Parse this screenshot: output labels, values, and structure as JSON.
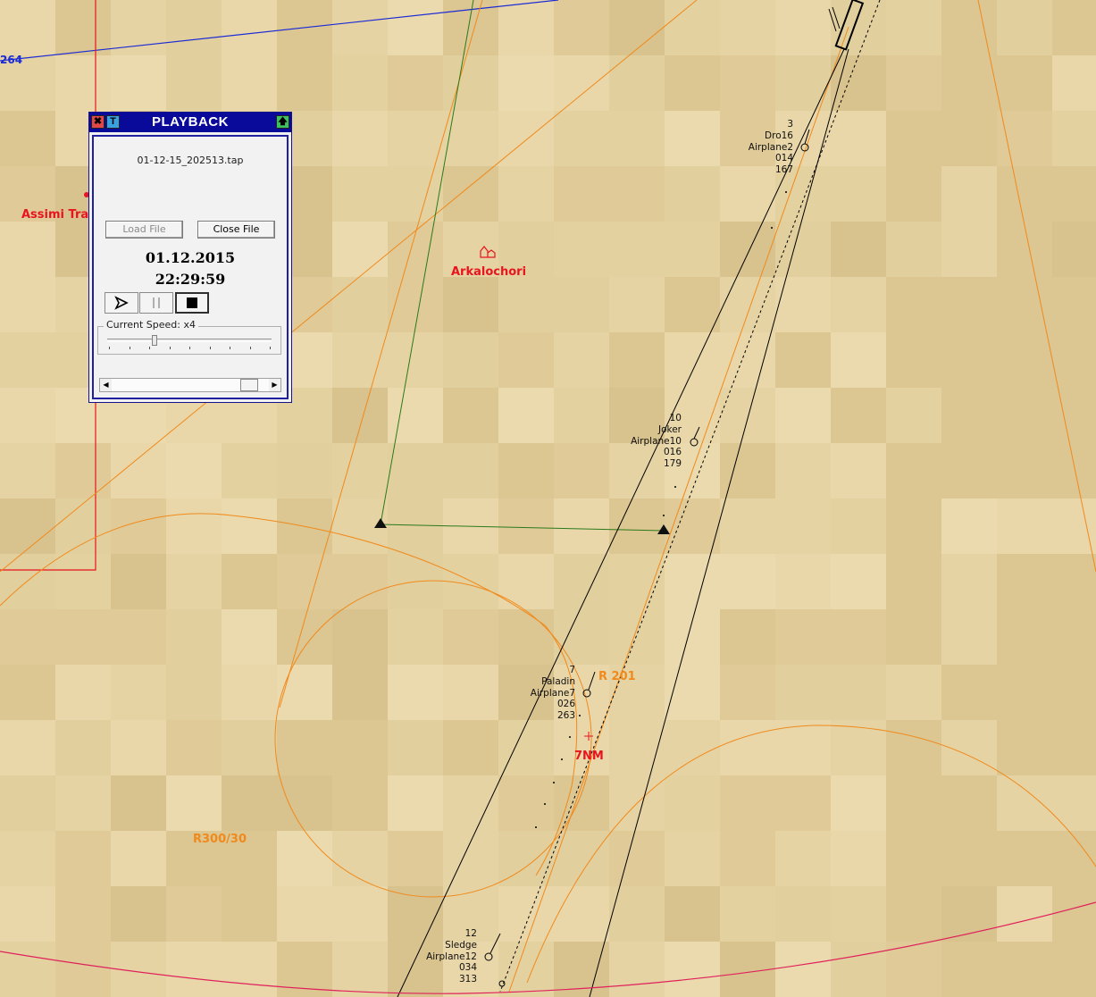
{
  "playback": {
    "title": "PLAYBACK",
    "close_glyph": "✖",
    "t_glyph": "T",
    "up_glyph": "🡅",
    "filename": "01-12-15_202513.tap",
    "load_label": "Load File",
    "close_label": "Close File",
    "date": "01.12.2015",
    "time": "22:29:59",
    "speed_label": "Current Speed: x4",
    "speed_fraction": 0.28,
    "position_fraction": 0.92
  },
  "map": {
    "labels": {
      "assimi": "Assimi Tra",
      "arkalochori": "Arkalochori",
      "r201": "R 201",
      "seven_nm": "7NM",
      "r300": "R300/30",
      "blue_264": "264"
    },
    "colors": {
      "background": "#e6d3a3",
      "orange": "#f08a1c",
      "red": "#e8141e",
      "blue": "#1b2bd6",
      "green": "#2a7a1a",
      "magenta": "#e0205a"
    }
  },
  "tracks": [
    {
      "id": "airplane2",
      "lines": [
        "3",
        "Dro16",
        "Airplane2",
        "014",
        "167"
      ]
    },
    {
      "id": "airplane10",
      "lines": [
        "10",
        "Joker",
        "Airplane10",
        "016",
        "179"
      ]
    },
    {
      "id": "airplane7",
      "lines": [
        "7",
        "Paladin",
        "Airplane7",
        "026",
        "263"
      ]
    },
    {
      "id": "airplane12",
      "lines": [
        "12",
        "Sledge",
        "Airplane12",
        "034",
        "313"
      ]
    }
  ]
}
